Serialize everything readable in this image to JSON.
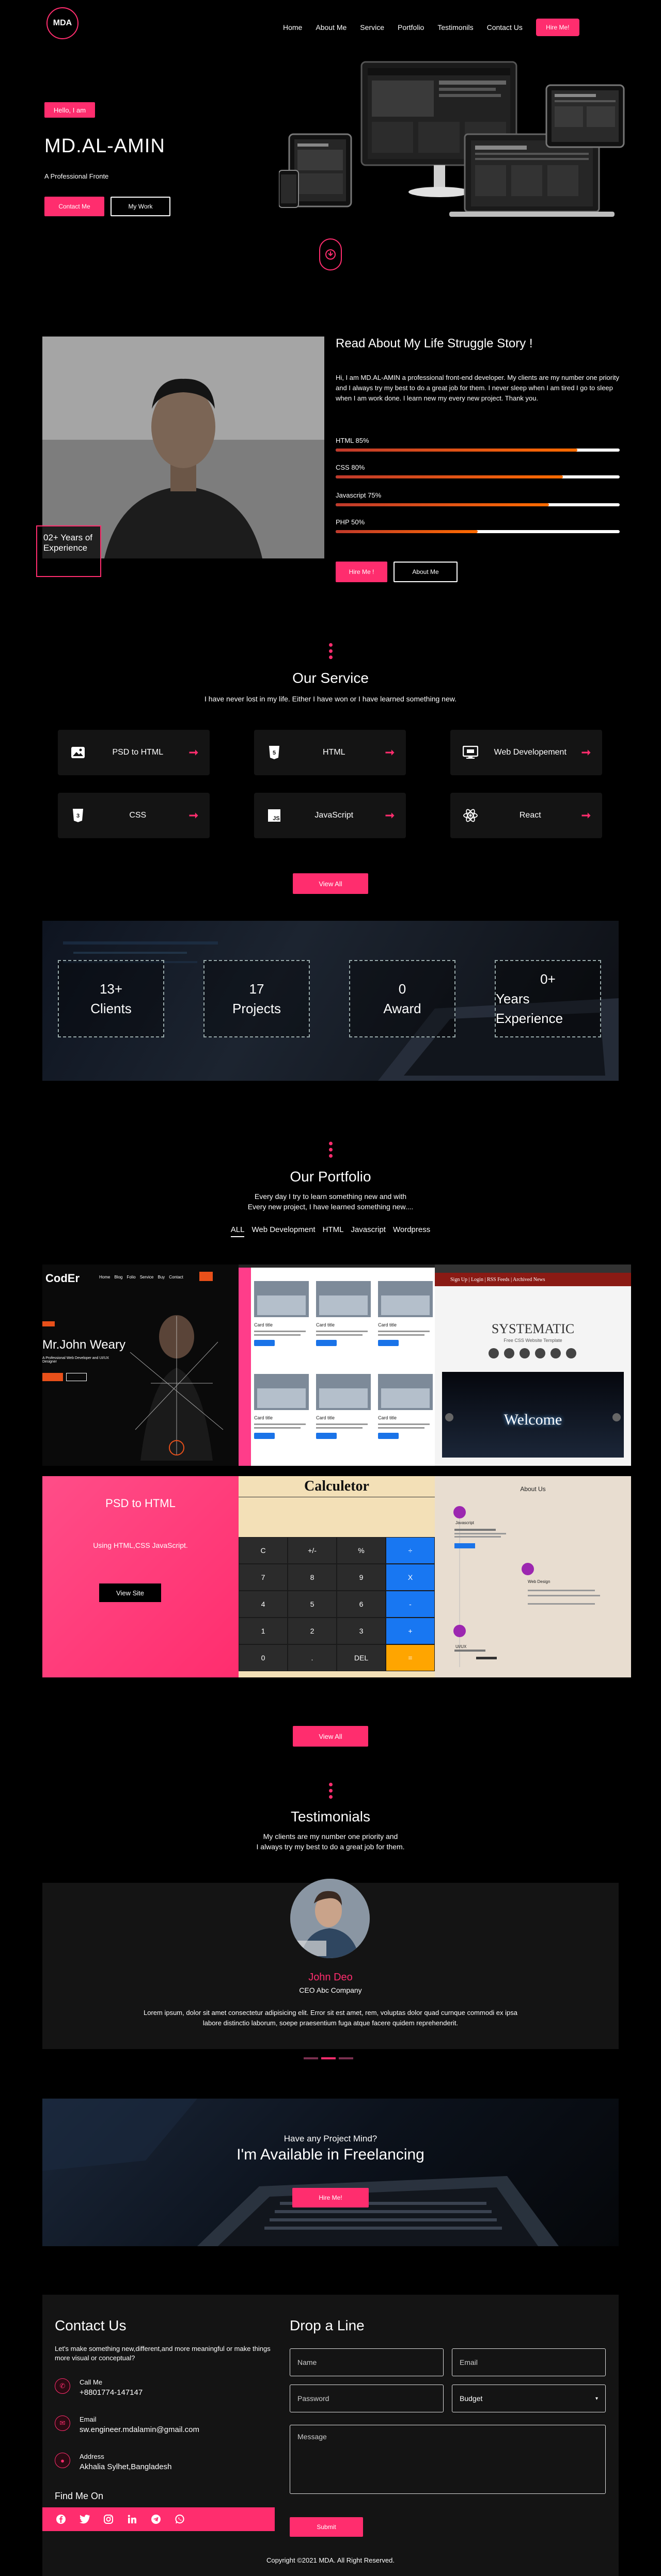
{
  "nav": {
    "logo": "MDA",
    "items": [
      "Home",
      "About Me",
      "Service",
      "Portfolio",
      "Testimonils",
      "Contact Us"
    ],
    "hire": "Hire Me!"
  },
  "hero": {
    "hello": "Hello, I am",
    "name": "MD.AL-AMIN",
    "tagline": "A Professional Fronte",
    "contact_btn": "Contact Me",
    "work_btn": "My Work"
  },
  "about": {
    "experience": "02+ Years of Experience",
    "title": "Read About My Life Struggle Story !",
    "text": "Hi, I am MD.AL-AMIN a professional front-end developer. My clients are my number one priority and I always try my best to do a great job for them. I never sleep when I am tired I go to sleep when I am work done. I learn new my every new project. Thank you.",
    "skills": [
      {
        "label": "HTML 85%",
        "value": 85
      },
      {
        "label": "CSS 80%",
        "value": 80
      },
      {
        "label": "Javascript 75%",
        "value": 75
      },
      {
        "label": "PHP 50%",
        "value": 50
      }
    ],
    "hire_btn": "Hire Me !",
    "about_btn": "About Me"
  },
  "services": {
    "title": "Our Service",
    "subtitle": "I have never lost in my life. Either I have won or I have learned something new.",
    "items": [
      {
        "label": "PSD to HTML",
        "icon": "image-icon"
      },
      {
        "label": "HTML",
        "icon": "html5-icon"
      },
      {
        "label": "Web Developement",
        "icon": "monitor-icon"
      },
      {
        "label": "CSS",
        "icon": "css3-icon"
      },
      {
        "label": "JavaScript",
        "icon": "javascript-icon"
      },
      {
        "label": "React",
        "icon": "react-icon"
      }
    ],
    "view_all": "View All"
  },
  "stats": [
    {
      "value": "13+",
      "label": "Clients"
    },
    {
      "value": "17",
      "label": "Projects"
    },
    {
      "value": "0",
      "label": "Award"
    },
    {
      "value": "0+",
      "label": "Years Experience"
    }
  ],
  "portfolio": {
    "title": "Our Portfolio",
    "subtitle_1": "Every day I try to learn something new and with",
    "subtitle_2": "Every new project, I have learned something new....",
    "filters": [
      "ALL",
      "Web Development",
      "HTML",
      "Javascript",
      "Wordpress"
    ],
    "view_all": "View All",
    "p1": {
      "logo": "CodEr",
      "menu": [
        "Home",
        "Blog",
        "Folio",
        "Service",
        "Buy",
        "Contact"
      ],
      "name": "Mr.John Weary",
      "sub": "A Professional Web Developer and UI/UX Designer"
    },
    "p2": {
      "card_title": "Card title"
    },
    "p3": {
      "nav": "Sign Up | Login | RSS Feeds | Archived News",
      "brand": "SYSTEMATIC",
      "brand_sub": "Free CSS Website Template",
      "banner": "Welcome"
    },
    "p4": {
      "title": "PSD to HTML",
      "sub": "Using HTML,CSS JavaScript.",
      "btn": "View Site"
    },
    "p5": {
      "title": "Calculetor",
      "keys": [
        "C",
        "+/-",
        "%",
        "÷",
        "7",
        "8",
        "9",
        "X",
        "4",
        "5",
        "6",
        "-",
        "1",
        "2",
        "3",
        "+",
        "0",
        ".",
        "DEL",
        "="
      ]
    },
    "p6": {
      "title": "About Us",
      "items": [
        "Javascript",
        "Web Design",
        "UI/UX"
      ]
    }
  },
  "testimonials": {
    "title": "Testimonials",
    "subtitle_1": "My clients are my number one priority and",
    "subtitle_2": "I always try my best to do a great job for them.",
    "name": "John Deo",
    "role": "CEO Abc Company",
    "text": "Lorem ipsum, dolor sit amet consectetur adipisicing elit. Error sit est amet, rem, voluptas dolor quad curnque commodi ex ipsa labore distinctio laborum, soepe praesentium fuga atque facere quidem reprehenderit."
  },
  "freelance": {
    "question": "Have any Project Mind?",
    "title": "I'm Available in Freelancing",
    "btn": "Hire Me!"
  },
  "contact": {
    "title": "Contact Us",
    "text": "Let's make something new,different,and more meaningful or make things more visual or conceptual?",
    "call_label": "Call Me",
    "call_value": "+8801774-147147",
    "email_label": "Email",
    "email_value": "sw.engineer.mdalamin@gmail.com",
    "address_label": "Address",
    "address_value": "Akhalia Sylhet,Bangladesh",
    "find_me": "Find Me On",
    "socials": [
      "facebook-icon",
      "twitter-icon",
      "instagram-icon",
      "linkedin-icon",
      "telegram-icon",
      "whatsapp-icon"
    ],
    "form_title": "Drop a Line",
    "name_ph": "Name",
    "email_ph": "Email",
    "password_ph": "Password",
    "budget": "Budget",
    "message_ph": "Message",
    "submit": "Submit"
  },
  "footer": {
    "copyright": "Copyright ©2021 MDA. All Right Reserved."
  }
}
